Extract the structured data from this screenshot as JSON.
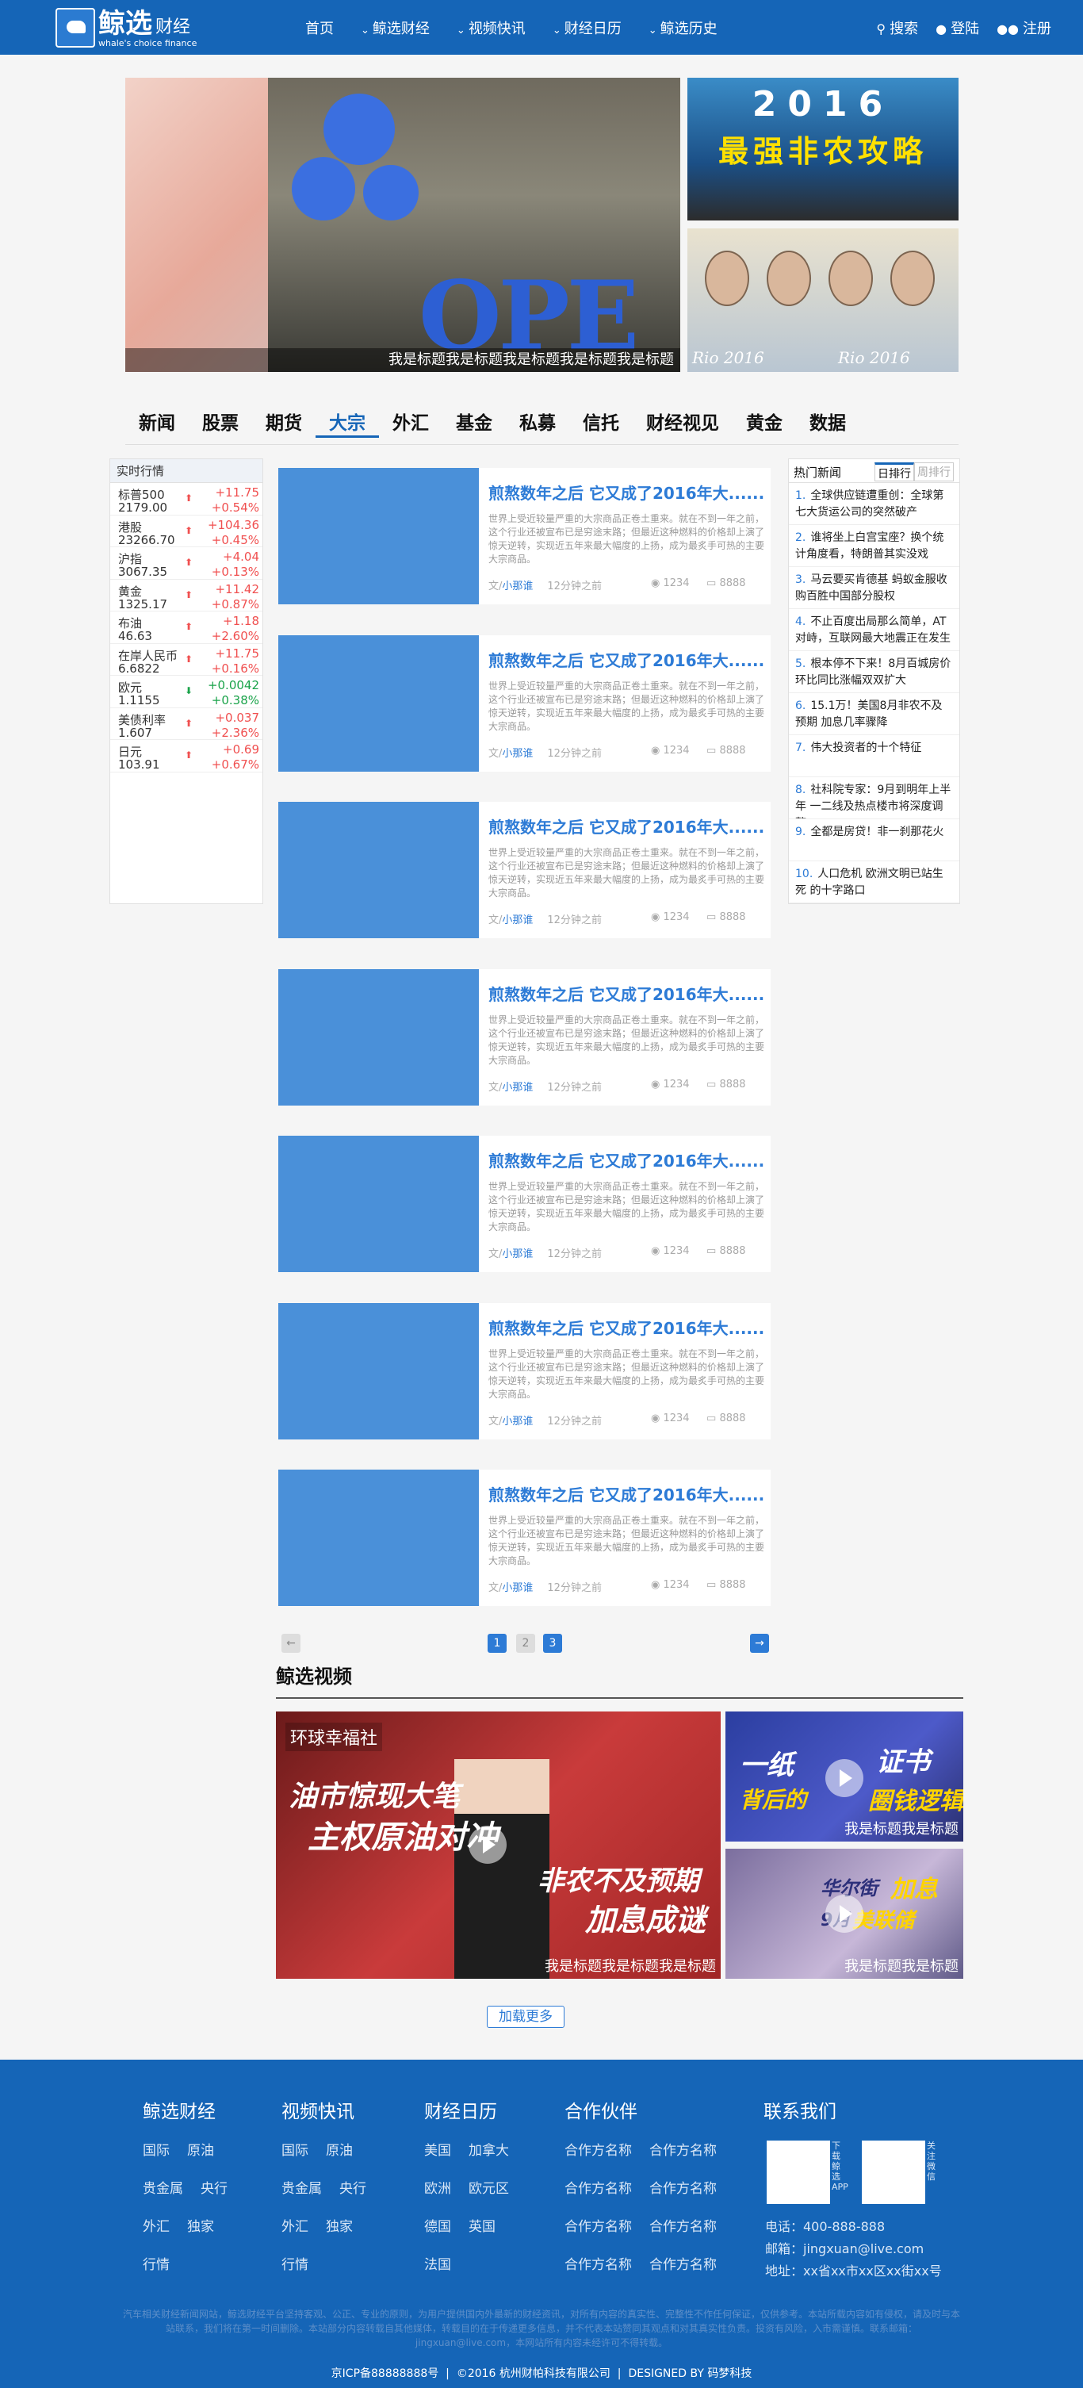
{
  "header": {
    "logo_cn": "鲸选",
    "logo_cn_sub": "财经",
    "logo_en": "whale's choice  finance",
    "nav": [
      {
        "label": "首页",
        "chevron": false
      },
      {
        "label": "鲸选财经",
        "chevron": true
      },
      {
        "label": "视频快讯",
        "chevron": true
      },
      {
        "label": "财经日历",
        "chevron": true
      },
      {
        "label": "鲸选历史",
        "chevron": true
      }
    ],
    "search": "搜索",
    "login": "登陆",
    "register": "注册"
  },
  "banner": {
    "caption": "我是标题我是标题我是标题我是标题我是标题",
    "main_text": "OPE",
    "side1_line1": "2016",
    "side1_line2": "最强非农攻略",
    "side2_text_left": "Rio 2016",
    "side2_text_right": "Rio 2016"
  },
  "categories": [
    "新闻",
    "股票",
    "期货",
    "大宗",
    "外汇",
    "基金",
    "私募",
    "信托",
    "财经视见",
    "黄金",
    "数据"
  ],
  "active_category": "大宗",
  "market": {
    "title": "实时行情",
    "rows": [
      {
        "name": "标普500",
        "value": "2179.00",
        "change": "+11.75",
        "pct": "+0.54%",
        "dir": "up"
      },
      {
        "name": "港股",
        "value": "23266.70",
        "change": "+104.36",
        "pct": "+0.45%",
        "dir": "up"
      },
      {
        "name": "沪指",
        "value": "3067.35",
        "change": "+4.04",
        "pct": "+0.13%",
        "dir": "up"
      },
      {
        "name": "黄金",
        "value": "1325.17",
        "change": "+11.42",
        "pct": "+0.87%",
        "dir": "up"
      },
      {
        "name": "布油",
        "value": "46.63",
        "change": "+1.18",
        "pct": "+2.60%",
        "dir": "up"
      },
      {
        "name": "在岸人民币",
        "value": "6.6822",
        "change": "+11.75",
        "pct": "+0.16%",
        "dir": "up"
      },
      {
        "name": "欧元",
        "value": "1.1155",
        "change": "+0.0042",
        "pct": "+0.38%",
        "dir": "down"
      },
      {
        "name": "美债利率",
        "value": "1.607",
        "change": "+0.037",
        "pct": "+2.36%",
        "dir": "up"
      },
      {
        "name": "日元",
        "value": "103.91",
        "change": "+0.69",
        "pct": "+0.67%",
        "dir": "up"
      }
    ]
  },
  "articles": [
    {
      "title": "煎熬数年之后 它又成了2016年大......",
      "desc": "世界上受近较量严重的大宗商品正卷土重来。就在不到一年之前，这个行业还被宣布已是穷途末路；但最近这种燃料的价格却上演了惊天逆转，实现近五年来最大幅度的上扬，成为最炙手可热的主要大宗商品。",
      "author_prefix": "文/",
      "author": "小那谁",
      "time": "12分钟之前",
      "views": "1234",
      "comments": "8888"
    },
    {
      "title": "煎熬数年之后 它又成了2016年大......",
      "desc": "世界上受近较量严重的大宗商品正卷土重来。就在不到一年之前，这个行业还被宣布已是穷途末路；但最近这种燃料的价格却上演了惊天逆转，实现近五年来最大幅度的上扬，成为最炙手可热的主要大宗商品。",
      "author_prefix": "文/",
      "author": "小那谁",
      "time": "12分钟之前",
      "views": "1234",
      "comments": "8888"
    },
    {
      "title": "煎熬数年之后 它又成了2016年大......",
      "desc": "世界上受近较量严重的大宗商品正卷土重来。就在不到一年之前，这个行业还被宣布已是穷途末路；但最近这种燃料的价格却上演了惊天逆转，实现近五年来最大幅度的上扬，成为最炙手可热的主要大宗商品。",
      "author_prefix": "文/",
      "author": "小那谁",
      "time": "12分钟之前",
      "views": "1234",
      "comments": "8888"
    },
    {
      "title": "煎熬数年之后 它又成了2016年大......",
      "desc": "世界上受近较量严重的大宗商品正卷土重来。就在不到一年之前，这个行业还被宣布已是穷途末路；但最近这种燃料的价格却上演了惊天逆转，实现近五年来最大幅度的上扬，成为最炙手可热的主要大宗商品。",
      "author_prefix": "文/",
      "author": "小那谁",
      "time": "12分钟之前",
      "views": "1234",
      "comments": "8888"
    },
    {
      "title": "煎熬数年之后 它又成了2016年大......",
      "desc": "世界上受近较量严重的大宗商品正卷土重来。就在不到一年之前，这个行业还被宣布已是穷途末路；但最近这种燃料的价格却上演了惊天逆转，实现近五年来最大幅度的上扬，成为最炙手可热的主要大宗商品。",
      "author_prefix": "文/",
      "author": "小那谁",
      "time": "12分钟之前",
      "views": "1234",
      "comments": "8888"
    },
    {
      "title": "煎熬数年之后 它又成了2016年大......",
      "desc": "世界上受近较量严重的大宗商品正卷土重来。就在不到一年之前，这个行业还被宣布已是穷途末路；但最近这种燃料的价格却上演了惊天逆转，实现近五年来最大幅度的上扬，成为最炙手可热的主要大宗商品。",
      "author_prefix": "文/",
      "author": "小那谁",
      "time": "12分钟之前",
      "views": "1234",
      "comments": "8888"
    },
    {
      "title": "煎熬数年之后 它又成了2016年大......",
      "desc": "世界上受近较量严重的大宗商品正卷土重来。就在不到一年之前，这个行业还被宣布已是穷途末路；但最近这种燃料的价格却上演了惊天逆转，实现近五年来最大幅度的上扬，成为最炙手可热的主要大宗商品。",
      "author_prefix": "文/",
      "author": "小那谁",
      "time": "12分钟之前",
      "views": "1234",
      "comments": "8888"
    }
  ],
  "hot": {
    "title": "热门新闻",
    "tab_day": "日排行",
    "tab_week": "周排行",
    "items": [
      {
        "n": "1.",
        "text": "全球供应链遭重创：全球第七大货运公司的突然破产"
      },
      {
        "n": "2.",
        "text": "谁将坐上白宫宝座？换个统计角度看，特朗普其实没戏"
      },
      {
        "n": "3.",
        "text": "马云要买肯德基 蚂蚁金服收购百胜中国部分股权"
      },
      {
        "n": "4.",
        "text": "不止百度出局那么简单，AT对峙，互联网最大地震正在发生"
      },
      {
        "n": "5.",
        "text": "根本停不下来！8月百城房价环比同比涨幅双双扩大"
      },
      {
        "n": "6.",
        "text": "15.1万！美国8月非农不及预期 加息几率骤降"
      },
      {
        "n": "7.",
        "text": "伟大投资者的十个特征"
      },
      {
        "n": "8.",
        "text": "社科院专家：9月到明年上半年 一二线及热点楼市将深度调整"
      },
      {
        "n": "9.",
        "text": "全都是房贷！非一刹那花火"
      },
      {
        "n": "10.",
        "text": "人口危机 欧洲文明已站生死 的十字路口"
      }
    ]
  },
  "pager": {
    "prev": "←",
    "pages": [
      "1",
      "2",
      "3"
    ],
    "next": "→"
  },
  "video": {
    "section_title": "鲸选视频",
    "main": {
      "brand": "环球幸福社",
      "t1": "油市惊现大笔",
      "t2": "主权原油对冲",
      "t3": "非农不及预期",
      "t4": "加息成谜",
      "caption": "我是标题我是标题我是标题"
    },
    "small": [
      {
        "big1": "一纸",
        "big2": "证书",
        "big3": "背后的",
        "big4": "圈钱逻辑",
        "caption": "我是标题我是标题"
      },
      {
        "big1": "华尔街",
        "big2": "加息",
        "big3": "9月",
        "big4": "美联储",
        "caption": "我是标题我是标题"
      }
    ],
    "load_more": "加载更多"
  },
  "footer": {
    "col1": {
      "title": "鲸选财经",
      "links": [
        [
          "国际",
          "原油"
        ],
        [
          "贵金属",
          "央行"
        ],
        [
          "外汇",
          "独家"
        ],
        [
          "行情"
        ]
      ]
    },
    "col2": {
      "title": "视频快讯",
      "links": [
        [
          "国际",
          "原油"
        ],
        [
          "贵金属",
          "央行"
        ],
        [
          "外汇",
          "独家"
        ],
        [
          "行情"
        ]
      ]
    },
    "col3": {
      "title": "财经日历",
      "links": [
        [
          "美国",
          "加拿大"
        ],
        [
          "欧洲",
          "欧元区"
        ],
        [
          "德国",
          "英国"
        ],
        [
          "法国"
        ]
      ]
    },
    "col4": {
      "title": "合作伙伴",
      "links": [
        [
          "合作方名称",
          "合作方名称"
        ],
        [
          "合作方名称",
          "合作方名称"
        ],
        [
          "合作方名称",
          "合作方名称"
        ],
        [
          "合作方名称",
          "合作方名称"
        ]
      ]
    },
    "contact_title": "联系我们",
    "qr1_label": "下载鲸选APP",
    "qr2_label": "关注微信",
    "phone": "电话：400-888-888",
    "email": "邮箱：jingxuan@live.com",
    "address": "地址：xx省xx市xx区xx街xx号",
    "disclaimer": "汽车相关财经新闻网站，鲸选财经平台坚持客观、公正、专业的原则，为用户提供国内外最新的财经资讯，对所有内容的真实性、完整性不作任何保证，仅供参考。本站所载内容如有侵权，请及时与本站联系，我们将在第一时间删除。本站部分内容转载自其他媒体，转载目的在于传递更多信息，并不代表本站赞同其观点和对其真实性负责。投资有风险，入市需谨慎。联系邮箱：jingxuan@live.com，本网站所有内容未经许可不得转载。",
    "icp": "京ICP备88888888号",
    "copyright": "©2016 杭州财帕科技有限公司",
    "designed": "DESIGNED BY 码梦科技"
  }
}
